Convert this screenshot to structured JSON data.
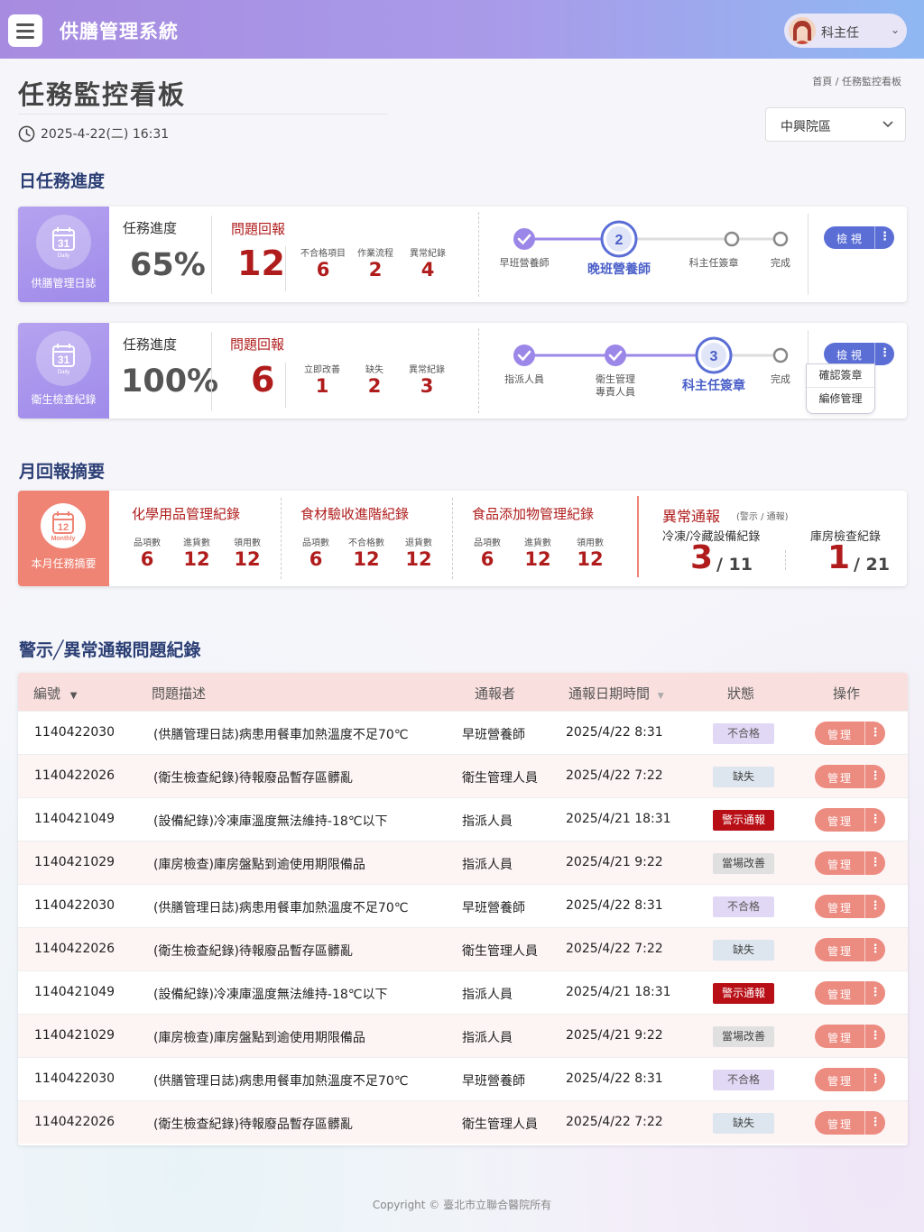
{
  "app": {
    "title": "供膳管理系統",
    "user": "科主任"
  },
  "page": {
    "title": "任務監控看板",
    "datetime": "2025-4-22(二) 16:31",
    "breadcrumb": "首頁 / 任務監控看板",
    "campus": "中興院區"
  },
  "daily": {
    "section_title": "日任務進度",
    "cards": [
      {
        "badge_label": "供膳管理日誌",
        "badge_number": "31",
        "badge_sub": "Daily",
        "progress_label": "任務進度",
        "progress_value": "65%",
        "issue_title": "問題回報",
        "issue_total": "12",
        "metrics": [
          {
            "label": "不合格項目",
            "value": "6"
          },
          {
            "label": "作業流程",
            "value": "2"
          },
          {
            "label": "異常紀錄",
            "value": "4"
          }
        ],
        "steps": [
          {
            "label": "早班營養師",
            "state": "done"
          },
          {
            "label": "晚班營養師",
            "state": "current",
            "number": "2"
          },
          {
            "label": "科主任簽章",
            "state": "todo"
          },
          {
            "label": "完成",
            "state": "todo"
          }
        ],
        "view_button": "檢 視"
      },
      {
        "badge_label": "衛生檢查紀錄",
        "badge_number": "31",
        "badge_sub": "Daily",
        "progress_label": "任務進度",
        "progress_value": "100%",
        "issue_title": "問題回報",
        "issue_total": "6",
        "metrics": [
          {
            "label": "立即改善",
            "value": "1"
          },
          {
            "label": "缺失",
            "value": "2"
          },
          {
            "label": "異常紀錄",
            "value": "3"
          }
        ],
        "steps": [
          {
            "label": "指派人員",
            "state": "done"
          },
          {
            "label": "衛生管理",
            "label2": "專責人員",
            "state": "done"
          },
          {
            "label": "科主任簽章",
            "state": "current",
            "number": "3"
          },
          {
            "label": "完成",
            "state": "todo"
          }
        ],
        "view_button": "檢 視",
        "menu": [
          "確認簽章",
          "編修管理"
        ]
      }
    ]
  },
  "monthly": {
    "section_title": "月回報摘要",
    "badge_label": "本月任務摘要",
    "badge_number": "12",
    "badge_sub": "Monthly",
    "groups": [
      {
        "title": "化學用品管理紀錄",
        "items": [
          {
            "label": "品項數",
            "value": "6"
          },
          {
            "label": "進貨數",
            "value": "12"
          },
          {
            "label": "領用數",
            "value": "12"
          }
        ]
      },
      {
        "title": "食材驗收進階紀錄",
        "items": [
          {
            "label": "品項數",
            "value": "6"
          },
          {
            "label": "不合格數",
            "value": "12"
          },
          {
            "label": "退貨數",
            "value": "12"
          }
        ]
      },
      {
        "title": "食品添加物管理紀錄",
        "items": [
          {
            "label": "品項數",
            "value": "6"
          },
          {
            "label": "進貨數",
            "value": "12"
          },
          {
            "label": "領用數",
            "value": "12"
          }
        ]
      }
    ],
    "anomaly": {
      "title": "異常通報",
      "subtitle": "(警示 / 通報)",
      "left_label": "冷凍/冷藏設備紀錄",
      "left_value": "3",
      "left_total": "/ 11",
      "right_label": "庫房檢查紀錄",
      "right_value": "1",
      "right_total": "/ 21"
    }
  },
  "alerts": {
    "section_title": "警示╱異常通報問題紀錄",
    "headers": {
      "id": "編號",
      "desc": "問題描述",
      "reporter": "通報者",
      "date": "通報日期時間",
      "status": "狀態",
      "action": "操作"
    },
    "manage_label": "管理",
    "rows": [
      {
        "id": "1140422030",
        "desc": "(供膳管理日誌)病患用餐車加熱溫度不足70℃",
        "reporter": "早班營養師",
        "date": "2025/4/22 8:31",
        "status": "不合格",
        "status_type": "fail"
      },
      {
        "id": "1140422026",
        "desc": "(衛生檢查紀錄)待報廢品暫存區髒亂",
        "reporter": "衛生管理人員",
        "date": "2025/4/22 7:22",
        "status": "缺失",
        "status_type": "miss"
      },
      {
        "id": "1140421049",
        "desc": "(設備紀錄)冷凍庫溫度無法維持-18℃以下",
        "reporter": "指派人員",
        "date": "2025/4/21 18:31",
        "status": "警示通報",
        "status_type": "alert"
      },
      {
        "id": "1140421029",
        "desc": "(庫房檢查)庫房盤點到逾使用期限備品",
        "reporter": "指派人員",
        "date": "2025/4/21 9:22",
        "status": "當場改善",
        "status_type": "fix"
      },
      {
        "id": "1140422030",
        "desc": "(供膳管理日誌)病患用餐車加熱溫度不足70℃",
        "reporter": "早班營養師",
        "date": "2025/4/22 8:31",
        "status": "不合格",
        "status_type": "fail"
      },
      {
        "id": "1140422026",
        "desc": "(衛生檢查紀錄)待報廢品暫存區髒亂",
        "reporter": "衛生管理人員",
        "date": "2025/4/22 7:22",
        "status": "缺失",
        "status_type": "miss"
      },
      {
        "id": "1140421049",
        "desc": "(設備紀錄)冷凍庫溫度無法維持-18℃以下",
        "reporter": "指派人員",
        "date": "2025/4/21 18:31",
        "status": "警示通報",
        "status_type": "alert"
      },
      {
        "id": "1140421029",
        "desc": "(庫房檢查)庫房盤點到逾使用期限備品",
        "reporter": "指派人員",
        "date": "2025/4/21 9:22",
        "status": "當場改善",
        "status_type": "fix"
      },
      {
        "id": "1140422030",
        "desc": "(供膳管理日誌)病患用餐車加熱溫度不足70℃",
        "reporter": "早班營養師",
        "date": "2025/4/22 8:31",
        "status": "不合格",
        "status_type": "fail"
      },
      {
        "id": "1140422026",
        "desc": "(衛生檢查紀錄)待報廢品暫存區髒亂",
        "reporter": "衛生管理人員",
        "date": "2025/4/22 7:22",
        "status": "缺失",
        "status_type": "miss"
      }
    ]
  },
  "footer": "Copyright © 臺北市立聯合醫院所有",
  "colors": {
    "primary": "#5a6ed6",
    "accent_red": "#b01c1c",
    "coral": "#ef8474",
    "header_bg": "#f9e0de"
  }
}
